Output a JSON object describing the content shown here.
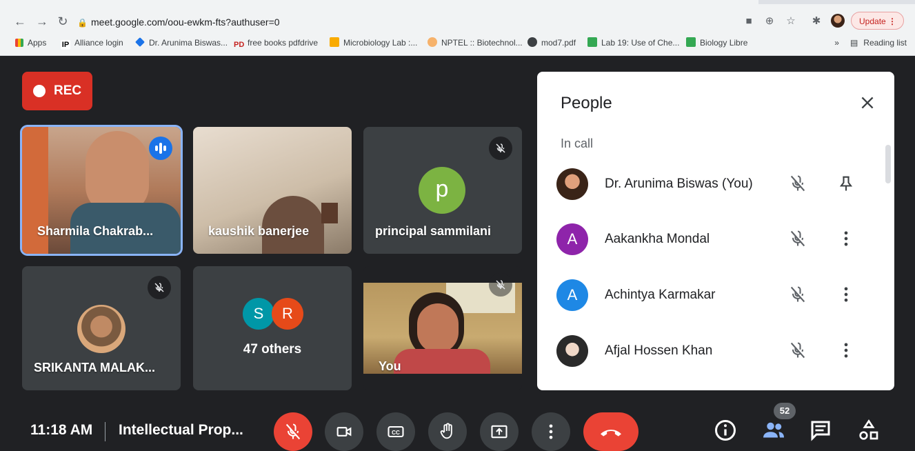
{
  "browser": {
    "url": "meet.google.com/oou-ewkm-fts?authuser=0",
    "update_label": "Update",
    "bookmarks": [
      {
        "label": "Apps"
      },
      {
        "label": "Alliance login"
      },
      {
        "label": "Dr. Arunima Biswas..."
      },
      {
        "label": "free books pdfdrive"
      },
      {
        "label": "Microbiology Lab :..."
      },
      {
        "label": "NPTEL :: Biotechnol..."
      },
      {
        "label": "mod7.pdf"
      },
      {
        "label": "Lab 19: Use of Che..."
      },
      {
        "label": "Biology Libre"
      }
    ],
    "reading_list": "Reading list",
    "overflow": "»"
  },
  "meet": {
    "rec_label": "REC",
    "tiles": [
      {
        "name": "Sharmila Chakrab..."
      },
      {
        "name": "kaushik banerjee"
      },
      {
        "name": "principal sammilani",
        "initial": "p"
      },
      {
        "name": "SRIKANTA MALAK..."
      },
      {
        "name": "47 others",
        "initials": [
          "S",
          "R"
        ]
      },
      {
        "name": "You"
      }
    ]
  },
  "people_panel": {
    "title": "People",
    "section": "In call",
    "people": [
      {
        "name": "Dr. Arunima Biswas (You)",
        "avatar": "photo"
      },
      {
        "name": "Aakankha Mondal",
        "avatar": "A",
        "color": "#8e24aa"
      },
      {
        "name": "Achintya Karmakar",
        "avatar": "A",
        "color": "#1e88e5"
      },
      {
        "name": "Afjal Hossen Khan",
        "avatar": "photo"
      }
    ]
  },
  "bottom_bar": {
    "time": "11:18 AM",
    "meeting_title": "Intellectual Prop...",
    "participants_count": "52"
  },
  "colors": {
    "accent": "#1a73e8",
    "danger": "#ea4335",
    "bg": "#202124",
    "tile": "#3c4043"
  }
}
